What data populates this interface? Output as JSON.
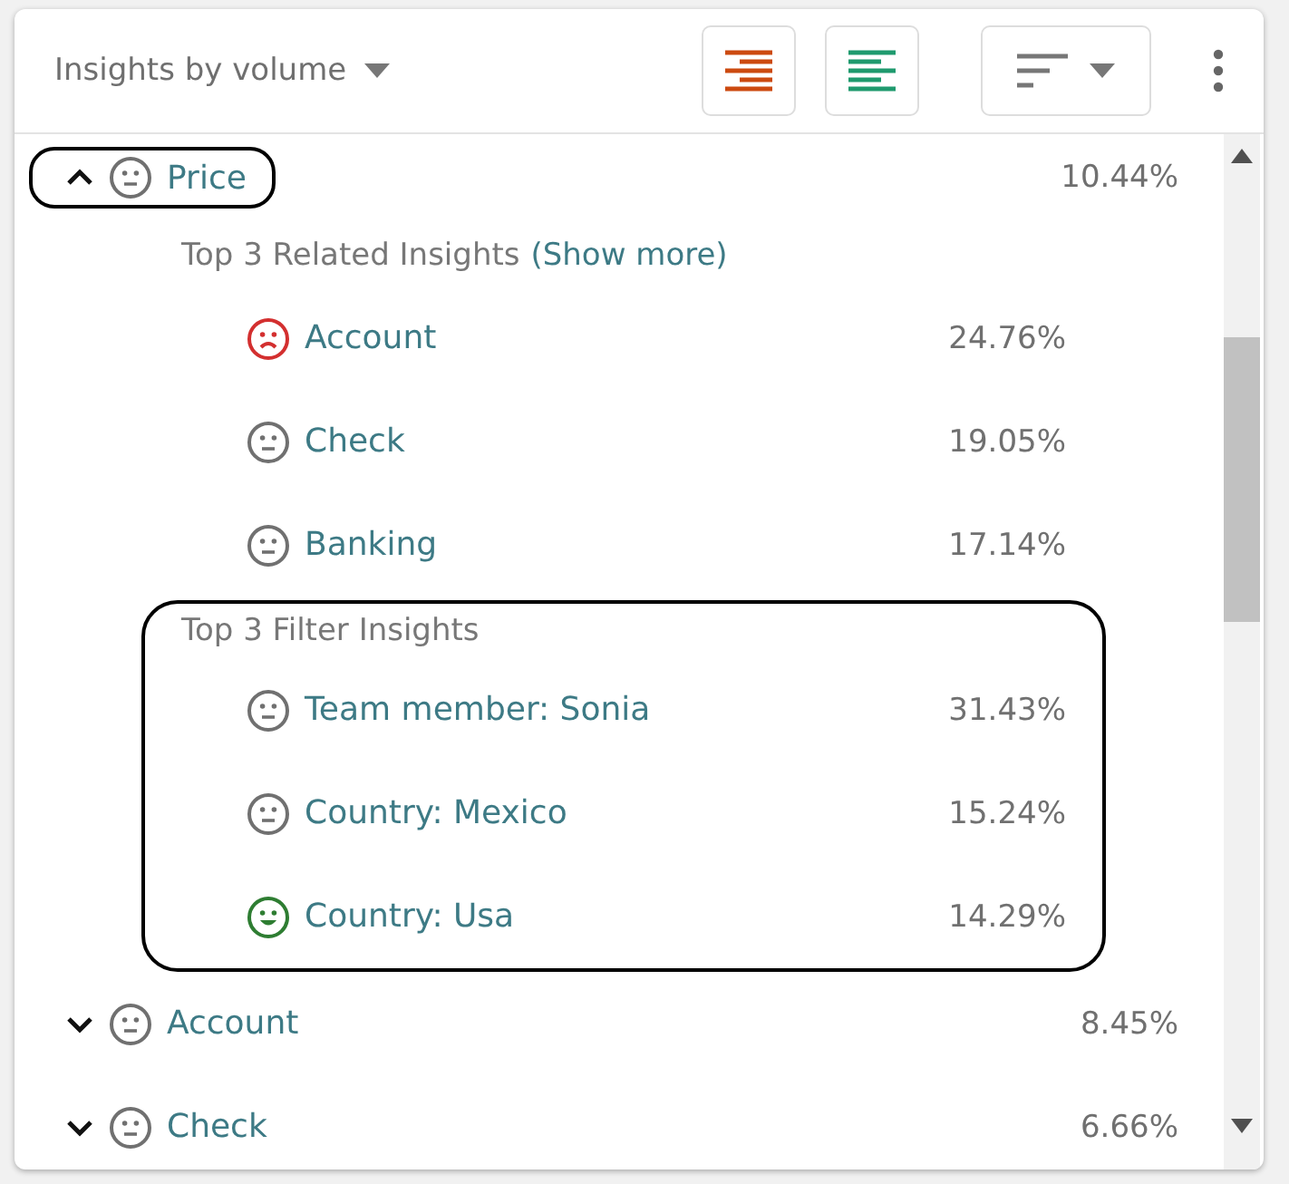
{
  "header": {
    "title": "Insights by volume",
    "buttons": [
      {
        "kind": "align-right",
        "selected": false
      },
      {
        "kind": "align-left",
        "selected": false
      },
      {
        "kind": "sort",
        "selected": false
      }
    ]
  },
  "topics": [
    {
      "label": "Price",
      "percent": "10.44%",
      "kind": "neutral",
      "color": "#707070",
      "expanded": true,
      "outlined": true,
      "sections": [
        {
          "title": "Top 3 Related Insights",
          "link": "(Show more)",
          "outlined": false,
          "items": [
            {
              "label": "Account",
              "percent": "24.76%",
              "kind": "sad",
              "color": "#d32f2f"
            },
            {
              "label": "Check",
              "percent": "19.05%",
              "kind": "neutral",
              "color": "#707070"
            },
            {
              "label": "Banking",
              "percent": "17.14%",
              "kind": "neutral",
              "color": "#707070"
            }
          ]
        },
        {
          "title": "Top 3 Filter Insights",
          "outlined": true,
          "items": [
            {
              "label": "Team member: Sonia",
              "percent": "31.43%",
              "kind": "neutral",
              "color": "#707070"
            },
            {
              "label": "Country: Mexico",
              "percent": "15.24%",
              "kind": "neutral",
              "color": "#707070"
            },
            {
              "label": "Country: Usa",
              "percent": "14.29%",
              "kind": "happy",
              "color": "#2e7d32"
            }
          ]
        }
      ]
    },
    {
      "label": "Account",
      "percent": "8.45%",
      "kind": "neutral",
      "color": "#707070",
      "expanded": false,
      "outlined": false
    },
    {
      "label": "Check",
      "percent": "6.66%",
      "kind": "neutral",
      "color": "#707070",
      "expanded": false,
      "outlined": false
    }
  ]
}
